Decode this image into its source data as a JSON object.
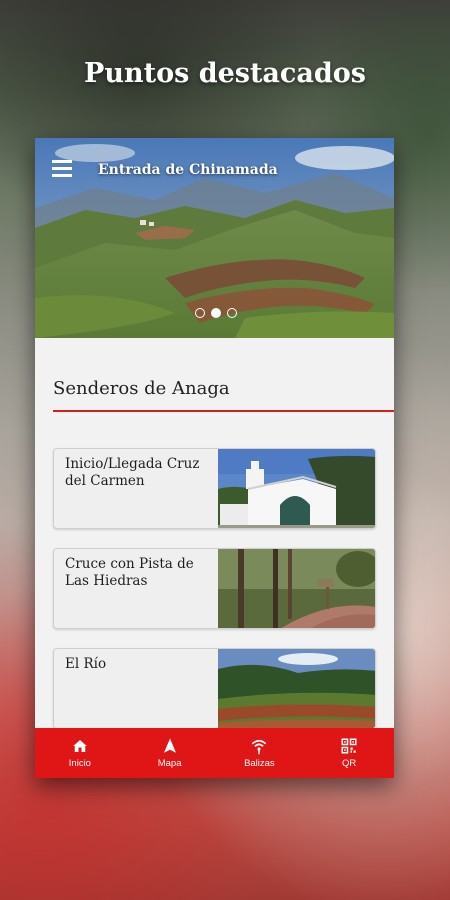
{
  "headline": "Puntos destacados",
  "hero": {
    "title": "Entrada de Chinamada",
    "carousel_total": 3,
    "carousel_active": 2
  },
  "section": {
    "title": "Senderos de Anaga"
  },
  "cards": [
    {
      "title": "Inicio/Llegada Cruz del Carmen",
      "image": "white-chapel-photo"
    },
    {
      "title": "Cruce con Pista de Las Hiedras",
      "image": "forest-path-photo"
    },
    {
      "title": "El Río",
      "image": "terraced-fields-photo"
    }
  ],
  "nav": [
    {
      "label": "Inicio",
      "icon": "home-icon"
    },
    {
      "label": "Mapa",
      "icon": "navigation-arrow-icon"
    },
    {
      "label": "Balizas",
      "icon": "beacon-signal-icon"
    },
    {
      "label": "QR",
      "icon": "qr-code-icon"
    }
  ],
  "colors": {
    "accent": "#e01515",
    "background": "#f2f2f2",
    "text": "#222222"
  }
}
